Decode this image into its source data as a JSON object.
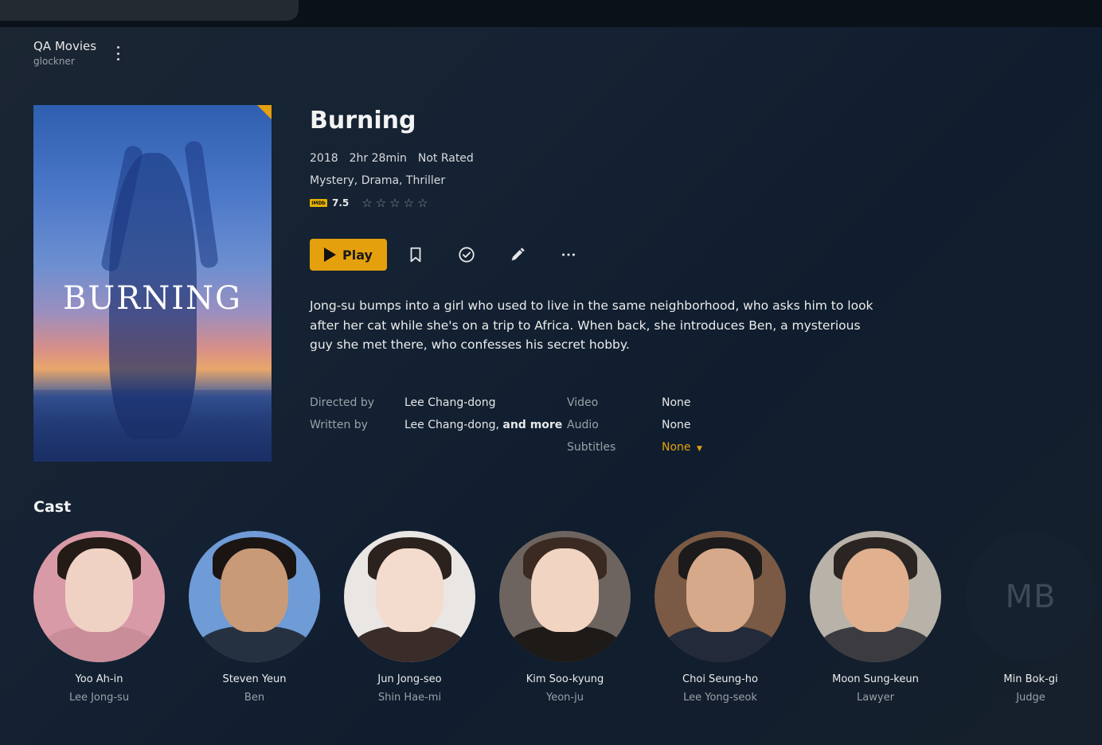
{
  "library": {
    "name": "QA Movies",
    "server": "glockner"
  },
  "poster": {
    "title_text": "BURNING",
    "accent": "#e5a00d"
  },
  "movie": {
    "title": "Burning",
    "year": "2018",
    "duration": "2hr 28min",
    "rating": "Not Rated",
    "genres": "Mystery, Drama, Thriller",
    "imdb_label": "IMDb",
    "imdb_score": "7.5",
    "user_stars": 0,
    "summary": "Jong-su bumps into a girl who used to live in the same neighborhood, who asks him to look after her cat while she's on a trip to Africa. When back, she introduces Ben, a mysterious guy she met there, who confesses his secret hobby."
  },
  "actions": {
    "play_label": "Play",
    "icons": [
      "bookmark-icon",
      "check-circle-icon",
      "pencil-icon",
      "more-icon"
    ]
  },
  "credits": {
    "directed_label": "Directed by",
    "directed_value": "Lee Chang-dong",
    "written_label": "Written by",
    "written_value": "Lee Chang-dong,",
    "written_more": "and more",
    "video_label": "Video",
    "video_value": "None",
    "audio_label": "Audio",
    "audio_value": "None",
    "subtitles_label": "Subtitles",
    "subtitles_value": "None"
  },
  "cast": {
    "heading": "Cast",
    "members": [
      {
        "name": "Yoo Ah-in",
        "role": "Lee Jong-su",
        "bg": "#d99aa8",
        "skin": "#f0d2c4",
        "hair": "#241a16",
        "cloth": "#c98d9a"
      },
      {
        "name": "Steven Yeun",
        "role": "Ben",
        "bg": "#6f9bd6",
        "skin": "#c99a78",
        "hair": "#1a1412",
        "cloth": "#253140"
      },
      {
        "name": "Jun Jong-seo",
        "role": "Shin Hae-mi",
        "bg": "#e9e6e3",
        "skin": "#f3dccd",
        "hair": "#2b211d",
        "cloth": "#3a2c28"
      },
      {
        "name": "Kim Soo-kyung",
        "role": "Yeon-ju",
        "bg": "#6e645f",
        "skin": "#f1d4c1",
        "hair": "#3b2a22",
        "cloth": "#1e1a18"
      },
      {
        "name": "Choi Seung-ho",
        "role": "Lee Yong-seok",
        "bg": "#7a5a44",
        "skin": "#d6a98a",
        "hair": "#1c1a1a",
        "cloth": "#232a3a"
      },
      {
        "name": "Moon Sung-keun",
        "role": "Lawyer",
        "bg": "#b8b2a8",
        "skin": "#e0b08f",
        "hair": "#2a2522",
        "cloth": "#3b3b40"
      },
      {
        "name": "Min Bok-gi",
        "role": "Judge",
        "initials": "MB",
        "bg": "#15212e"
      }
    ]
  }
}
